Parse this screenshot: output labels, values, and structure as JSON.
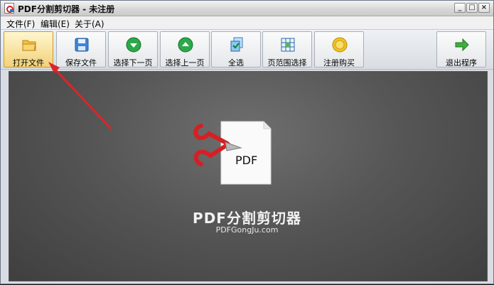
{
  "window": {
    "title": "PDF分割剪切器 - 未注册",
    "controls": [
      "minimize",
      "maximize",
      "close"
    ]
  },
  "menu": {
    "items": [
      "文件(F)",
      "编辑(E)",
      "关于(A)"
    ]
  },
  "toolbar": {
    "buttons": [
      {
        "label": "打开文件",
        "icon": "folder-icon"
      },
      {
        "label": "保存文件",
        "icon": "floppy-icon"
      },
      {
        "label": "选择下一页",
        "icon": "arrow-down-circle-icon"
      },
      {
        "label": "选择上一页",
        "icon": "arrow-up-circle-icon"
      },
      {
        "label": "全选",
        "icon": "pages-icon"
      },
      {
        "label": "页范围选择",
        "icon": "grid-icon"
      },
      {
        "label": "注册购买",
        "icon": "coin-icon"
      },
      {
        "label": "退出程序",
        "icon": "exit-arrow-icon"
      }
    ]
  },
  "content": {
    "logo_text": "PDF",
    "product_name": "PDF分割剪切器",
    "url": "PDFGongJu.com"
  },
  "colors": {
    "accent": "#d7262a",
    "content_bg": "#5b5b5b",
    "active_button": "#f2d27a"
  }
}
